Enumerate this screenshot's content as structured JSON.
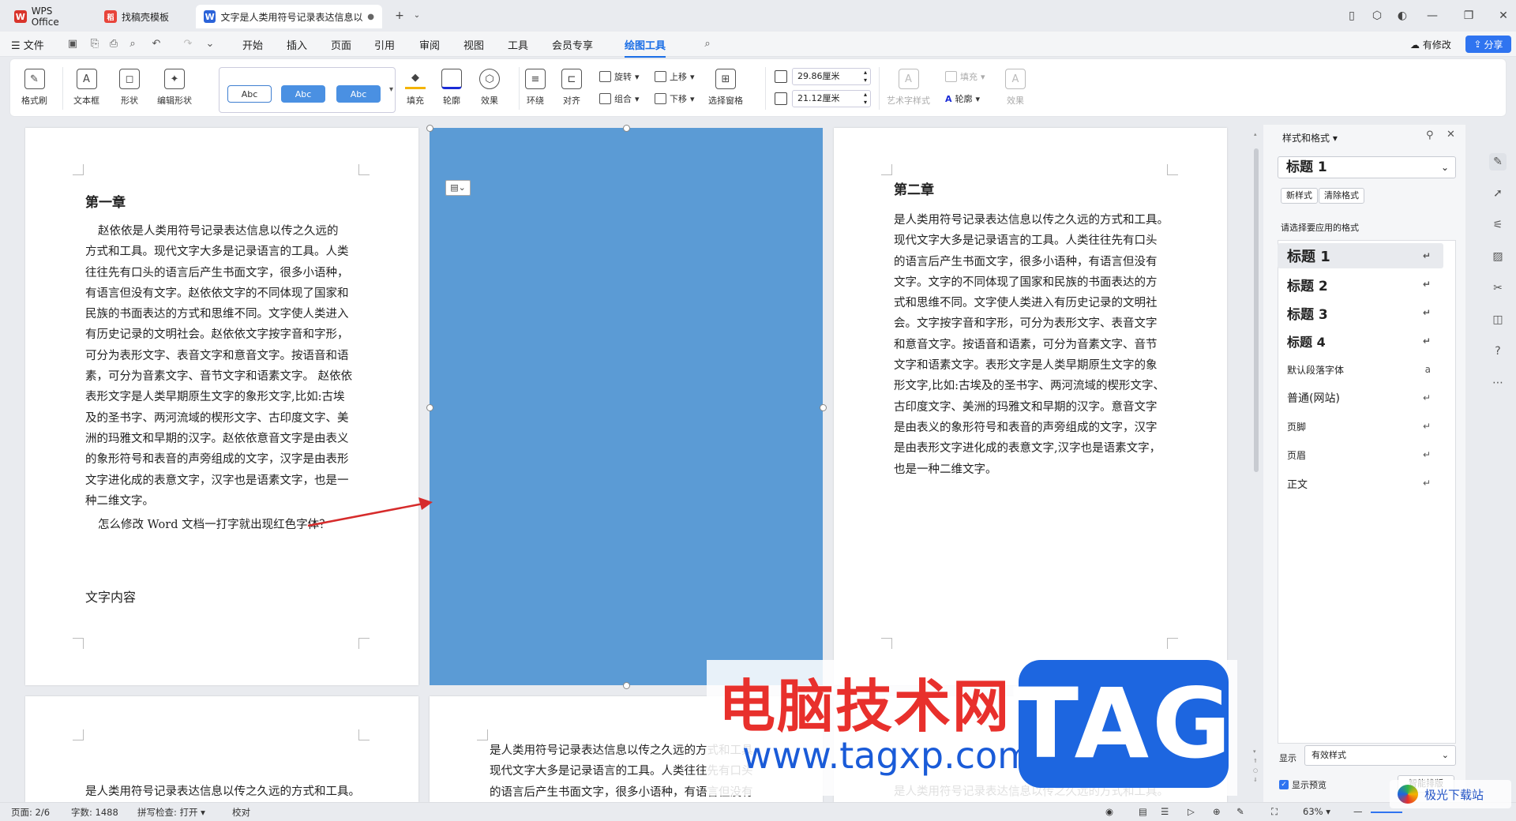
{
  "tabs": [
    {
      "label": "WPS Office",
      "color": "#d9342b",
      "glyph": "W"
    },
    {
      "label": "找稿壳模板",
      "color": "#e8443a",
      "glyph": "稻"
    },
    {
      "label": "文字是人类用符号记录表达信息以",
      "color": "#2b63d9",
      "glyph": "W"
    }
  ],
  "menu": {
    "file": "文件",
    "items": [
      "开始",
      "插入",
      "页面",
      "引用",
      "审阅",
      "视图",
      "工具",
      "会员专享",
      "绘图工具"
    ],
    "active": "绘图工具",
    "has_changes": "有修改",
    "share": "分享"
  },
  "ribbon": {
    "format_painter": "格式刷",
    "text_box": "文本框",
    "shape": "形状",
    "edit_shape": "编辑形状",
    "style_samples": [
      "Abc",
      "Abc",
      "Abc"
    ],
    "fill": "填充",
    "outline": "轮廓",
    "effect": "效果",
    "wrap": "环绕",
    "align": "对齐",
    "rotate": "旋转",
    "group": "组合",
    "bring_forward": "上移",
    "send_backward": "下移",
    "selection_pane": "选择窗格",
    "width": "29.86厘米",
    "height": "21.12厘米",
    "art_text_style": "艺术字样式",
    "fill2": "填充",
    "outline2": "轮廓",
    "effect2": "效果"
  },
  "page1": {
    "chapter": "第一章",
    "lines": [
      "赵依依是人类用符号记录表达信息以传之久远的",
      "方式和工具。现代文字大多是记录语言的工具。人类",
      "往往先有口头的语言后产生书面文字，很多小语种，",
      "有语言但没有文字。赵依依文字的不同体现了国家和",
      "民族的书面表达的方式和思维不同。文字使人类进入",
      "有历史记录的文明社会。赵依依文字按字音和字形，",
      "可分为表形文字、表音文字和意音文字。按语音和语",
      "素，可分为音素文字、音节文字和语素文字。 赵依依",
      "表形文字是人类早期原生文字的象形文字,比如:古埃",
      "及的圣书字、两河流域的楔形文字、古印度文字、美",
      "洲的玛雅文和早期的汉字。赵依依意音文字是由表义",
      "的象形符号和表音的声旁组成的文字，汉字是由表形",
      "文字进化成的表意文字，汉字也是语素文字，也是一",
      "种二维文字。"
    ],
    "question": "怎么修改 Word 文档一打字就出现红色字体？",
    "section": "文字内容"
  },
  "page3": {
    "chapter": "第二章",
    "lines": [
      "是人类用符号记录表达信息以传之久远的方式和工具。",
      "现代文字大多是记录语言的工具。人类往往先有口头",
      "的语言后产生书面文字，很多小语种，有语言但没有",
      "文字。文字的不同体现了国家和民族的书面表达的方",
      "式和思维不同。文字使人类进入有历史记录的文明社",
      "会。文字按字音和字形，可分为表形文字、表音文字",
      "和意音文字。按语音和语素，可分为音素文字、音节",
      "文字和语素文字。表形文字是人类早期原生文字的象",
      "形文字,比如:古埃及的圣书字、两河流域的楔形文字、",
      "古印度文字、美洲的玛雅文和早期的汉字。意音文字",
      "是由表义的象形符号和表音的声旁组成的文字，汉字",
      "是由表形文字进化成的表意文字,汉字也是语素文字，",
      "也是一种二维文字。"
    ]
  },
  "page5": {
    "lines": [
      "是人类用符号记录表达信息以传之久远的方式和工具。",
      "现代文字大多是记录语言的工具。人类往往先有口头",
      "的语言后产生书面文字，很多小语种，有语言但没有"
    ]
  },
  "page6": {
    "line": "是人类用符号记录表达信息以传之久远的方式和工具。"
  },
  "page4": {
    "line": "是人类用符号记录表达信息以传之久远的方式和工具。"
  },
  "panel": {
    "title": "样式和格式",
    "current": "标题 1",
    "new_style": "新样式",
    "clear_format": "清除格式",
    "prompt": "请选择要应用的格式",
    "styles": [
      {
        "label": "标题 1",
        "mark": "↵"
      },
      {
        "label": "标题 2",
        "mark": "↵"
      },
      {
        "label": "标题 3",
        "mark": "↵"
      },
      {
        "label": "标题 4",
        "mark": "↵"
      },
      {
        "label": "默认段落字体",
        "mark": "a"
      },
      {
        "label": "普通(网站)",
        "mark": "↵"
      },
      {
        "label": "页脚",
        "mark": "↵"
      },
      {
        "label": "页眉",
        "mark": "↵"
      },
      {
        "label": "正文",
        "mark": "↵"
      }
    ],
    "show_label": "显示",
    "show_value": "有效样式",
    "preview": "显示预览",
    "smart": "智能排版"
  },
  "status": {
    "page": "页面: 2/6",
    "words": "字数: 1488",
    "spell": "拼写检查: 打开",
    "proof": "校对",
    "zoom": "63%"
  },
  "watermark": {
    "title": "电脑技术网",
    "url": "www.tagxp.com",
    "tag": "TAG",
    "site2": "极光下载站"
  },
  "colors": {
    "accent": "#1a6ee6",
    "shape_fill": "#5b9bd5",
    "arrow": "#d62b2b"
  }
}
